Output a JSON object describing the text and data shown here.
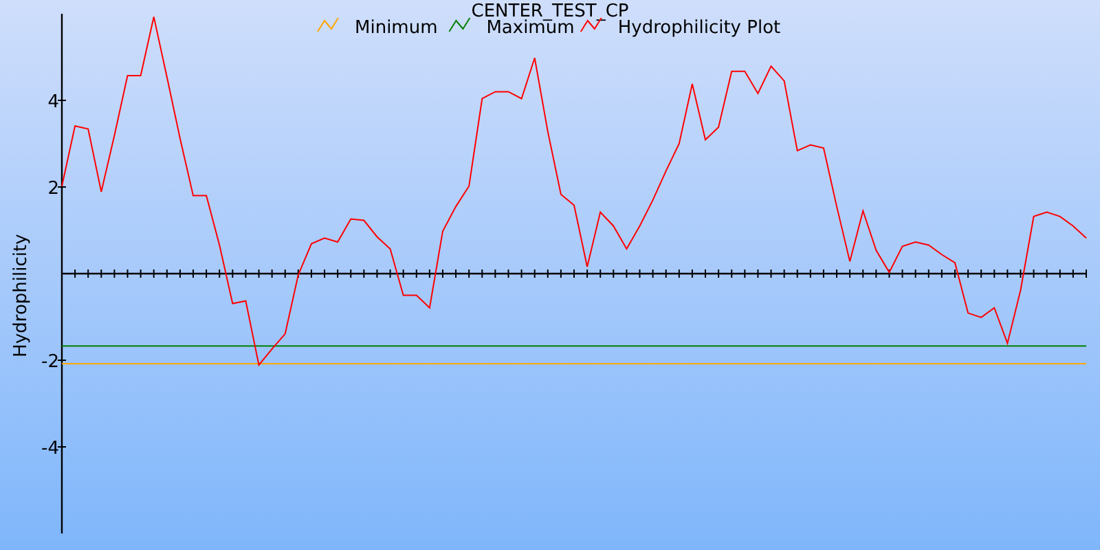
{
  "chart_data": {
    "type": "line",
    "title": "CENTER_TEST_CP",
    "legend": "top",
    "ylabel": "Hydrophilicity",
    "ylim": [
      -6,
      6
    ],
    "yticks": [
      -4,
      -2,
      2,
      4
    ],
    "series": [
      {
        "name": "Minimum",
        "color": "#ffa500",
        "values": [
          -2.08,
          -2.08,
          -2.08,
          -2.08,
          -2.08,
          -2.08,
          -2.08,
          -2.08,
          -2.08,
          -2.08,
          -2.08,
          -2.08,
          -2.08,
          -2.08,
          -2.08,
          -2.08,
          -2.08,
          -2.08,
          -2.08,
          -2.08,
          -2.08,
          -2.08,
          -2.08,
          -2.08,
          -2.08,
          -2.08,
          -2.08,
          -2.08,
          -2.08,
          -2.08,
          -2.08,
          -2.08,
          -2.08,
          -2.08,
          -2.08,
          -2.08,
          -2.08,
          -2.08,
          -2.08,
          -2.08,
          -2.08,
          -2.08,
          -2.08,
          -2.08,
          -2.08,
          -2.08,
          -2.08,
          -2.08,
          -2.08,
          -2.08,
          -2.08,
          -2.08,
          -2.08,
          -2.08,
          -2.08,
          -2.08,
          -2.08,
          -2.08,
          -2.08,
          -2.08,
          -2.08,
          -2.08,
          -2.08,
          -2.08,
          -2.08,
          -2.08,
          -2.08,
          -2.08,
          -2.08,
          -2.08,
          -2.08,
          -2.08,
          -2.08,
          -2.08,
          -2.08,
          -2.08,
          -2.08,
          -2.08,
          -2.08
        ]
      },
      {
        "name": "Maximum",
        "color": "#008000",
        "values": [
          -1.67,
          -1.67,
          -1.67,
          -1.67,
          -1.67,
          -1.67,
          -1.67,
          -1.67,
          -1.67,
          -1.67,
          -1.67,
          -1.67,
          -1.67,
          -1.67,
          -1.67,
          -1.67,
          -1.67,
          -1.67,
          -1.67,
          -1.67,
          -1.67,
          -1.67,
          -1.67,
          -1.67,
          -1.67,
          -1.67,
          -1.67,
          -1.67,
          -1.67,
          -1.67,
          -1.67,
          -1.67,
          -1.67,
          -1.67,
          -1.67,
          -1.67,
          -1.67,
          -1.67,
          -1.67,
          -1.67,
          -1.67,
          -1.67,
          -1.67,
          -1.67,
          -1.67,
          -1.67,
          -1.67,
          -1.67,
          -1.67,
          -1.67,
          -1.67,
          -1.67,
          -1.67,
          -1.67,
          -1.67,
          -1.67,
          -1.67,
          -1.67,
          -1.67,
          -1.67,
          -1.67,
          -1.67,
          -1.67,
          -1.67,
          -1.67,
          -1.67,
          -1.67,
          -1.67,
          -1.67,
          -1.67,
          -1.67,
          -1.67,
          -1.67,
          -1.67,
          -1.67,
          -1.67,
          -1.67,
          -1.67,
          -1.67
        ]
      },
      {
        "name": "Hydrophilicity Plot",
        "color": "#ff0000",
        "values": [
          2.02,
          3.41,
          3.34,
          1.89,
          3.19,
          4.57,
          4.57,
          5.93,
          4.54,
          3.12,
          1.8,
          1.8,
          0.66,
          -0.69,
          -0.63,
          -2.11,
          -1.74,
          -1.39,
          -0.03,
          0.69,
          0.82,
          0.73,
          1.26,
          1.23,
          0.85,
          0.57,
          -0.5,
          -0.5,
          -0.79,
          0.98,
          1.55,
          2.02,
          4.04,
          4.2,
          4.2,
          4.04,
          4.98,
          3.28,
          1.83,
          1.58,
          0.16,
          1.42,
          1.1,
          0.57,
          1.1,
          1.7,
          2.37,
          3.0,
          4.38,
          3.09,
          3.38,
          4.67,
          4.67,
          4.16,
          4.79,
          4.45,
          2.84,
          2.97,
          2.9,
          1.55,
          0.28,
          1.45,
          0.54,
          0.03,
          0.63,
          0.73,
          0.66,
          0.44,
          0.25,
          -0.91,
          -1.01,
          -0.79,
          -1.61,
          -0.38,
          1.32,
          1.42,
          1.32,
          1.1,
          0.82
        ]
      }
    ]
  }
}
